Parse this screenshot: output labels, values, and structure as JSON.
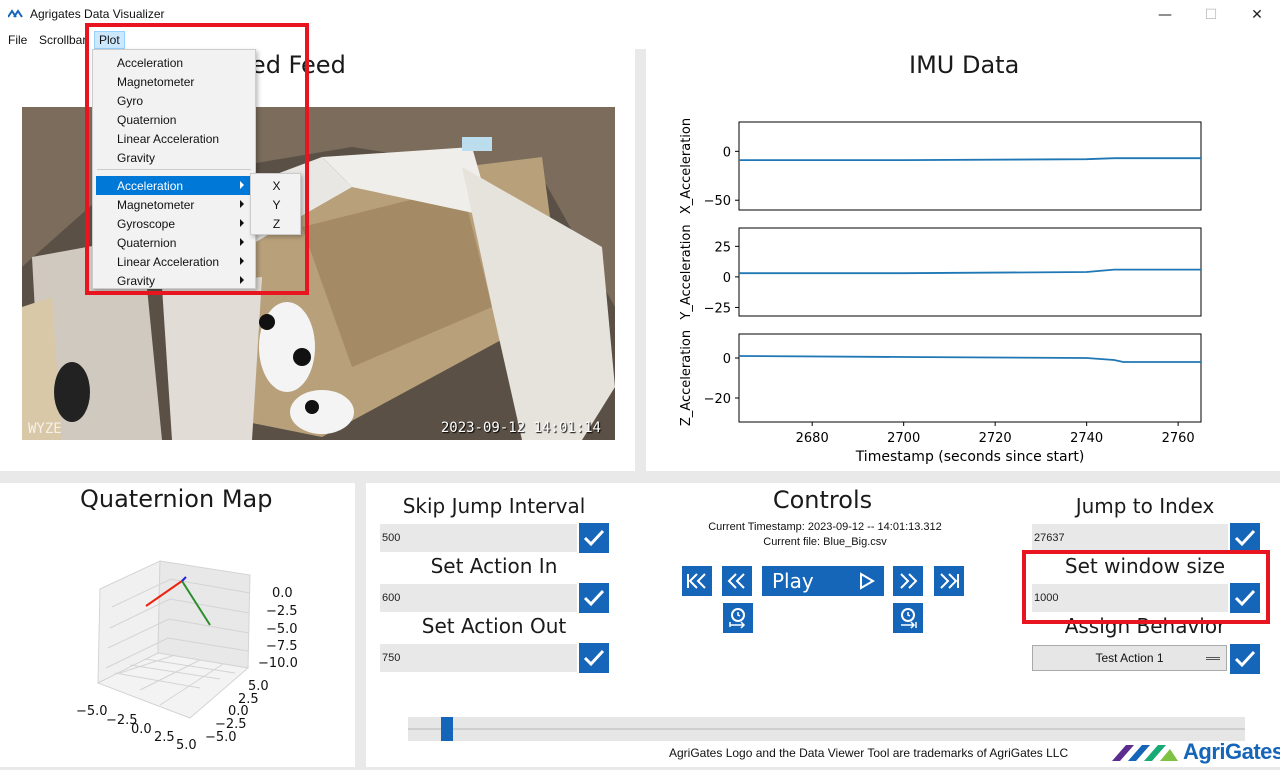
{
  "window": {
    "title": "Agrigates Data Visualizer",
    "minimize": "—",
    "maximize": "☐",
    "close": "✕"
  },
  "menu": {
    "file": "File",
    "scrollbar": "Scrollbar",
    "plot": "Plot"
  },
  "plot_menu": {
    "items": [
      "Acceleration",
      "Magnetometer",
      "Gyro",
      "Quaternion",
      "Linear Acceleration",
      "Gravity"
    ],
    "sub_items": [
      "Acceleration",
      "Magnetometer",
      "Gyroscope",
      "Quaternion",
      "Linear Acceleration",
      "Gravity"
    ],
    "selected": "Acceleration",
    "axes": [
      "X",
      "Y",
      "Z"
    ]
  },
  "feed": {
    "title": "Recorded Feed",
    "timestamp": "2023-09-12  14:01:14",
    "logo_text": "WYZE"
  },
  "imu": {
    "title": "IMU Data"
  },
  "chart_data": {
    "type": "line",
    "xlabel": "Timestamp (seconds since start)",
    "xlim": [
      2664,
      2765
    ],
    "xticks": [
      2680,
      2700,
      2720,
      2740,
      2760
    ],
    "subplots": [
      {
        "ylabel": "X_Acceleration",
        "ylim": [
          -60,
          30
        ],
        "yticks": [
          0,
          -50
        ],
        "x": [
          2664,
          2700,
          2740,
          2746,
          2750,
          2765
        ],
        "y": [
          -9,
          -9,
          -8,
          -7,
          -7,
          -7
        ]
      },
      {
        "ylabel": "Y_Acceleration",
        "ylim": [
          -32,
          40
        ],
        "yticks": [
          25,
          0,
          -25
        ],
        "x": [
          2664,
          2700,
          2740,
          2746,
          2750,
          2765
        ],
        "y": [
          3,
          3,
          4,
          6,
          6,
          6
        ]
      },
      {
        "ylabel": "Z_Acceleration",
        "ylim": [
          -32,
          12
        ],
        "yticks": [
          0,
          -20
        ],
        "x": [
          2664,
          2700,
          2740,
          2746,
          2748,
          2765
        ],
        "y": [
          1,
          0.5,
          0,
          -1,
          -2,
          -2
        ]
      }
    ],
    "color": "#1f77b4"
  },
  "quat": {
    "title": "Quaternion Map",
    "z_ticks": [
      "0.0",
      "−2.5",
      "−5.0",
      "−7.5",
      "−10.0"
    ],
    "y_ticks": [
      "5.0",
      "2.5",
      "0.0",
      "−2.5",
      "−5.0"
    ],
    "x_ticks": [
      "−5.0",
      "−2.5",
      "0.0",
      "2.5",
      "5.0"
    ]
  },
  "controls": {
    "title": "Controls",
    "skip_label": "Skip Jump Interval",
    "skip_value": "500",
    "action_in_label": "Set Action In",
    "action_in_value": "600",
    "action_out_label": "Set Action Out",
    "action_out_value": "750",
    "current_timestamp": "Current Timestamp: 2023-09-12 -- 14:01:13.312",
    "current_file": "Current file: Blue_Big.csv",
    "play_label": "Play",
    "jump_label": "Jump to Index",
    "jump_value": "27637",
    "window_label": "Set window size",
    "window_value": "1000",
    "behavior_label": "Assign Behavior",
    "behavior_value": "Test Action 1",
    "slider_value": 0.04
  },
  "footer": {
    "trademark": "AgriGates Logo and the Data Viewer Tool are trademarks of AgriGates LLC",
    "brand": "AgriGates"
  }
}
